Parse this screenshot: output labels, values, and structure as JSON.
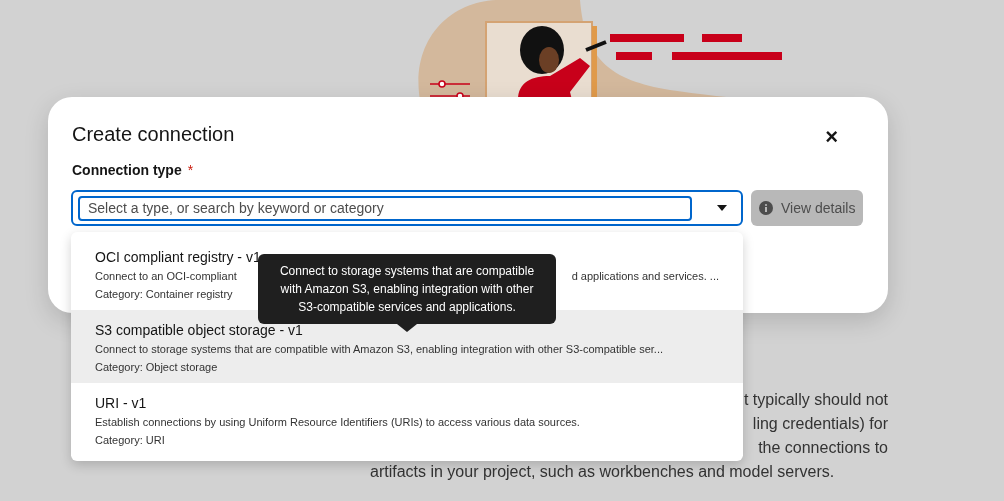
{
  "background_text": {
    "line_ends": [
      "t typically should not",
      "ling credentials) for",
      "the connections to"
    ],
    "last_line": "artifacts in your project, such as workbenches and model servers."
  },
  "modal": {
    "title": "Create connection",
    "close": "×",
    "field": {
      "label": "Connection type",
      "required": "*",
      "placeholder": "Select a type, or search by keyword or category"
    },
    "view_details": {
      "label": "View details",
      "disabled": true
    }
  },
  "dropdown": {
    "items": [
      {
        "title": "OCI compliant registry - v1",
        "description": [
          "Connect to an OCI-compliant",
          "d applications and services. ..."
        ],
        "category": "Category: Container registry",
        "highlighted": false
      },
      {
        "title": "S3 compatible object storage - v1",
        "description": [
          "Connect to storage systems that are compatible with Amazon S3, enabling integration with other S3-compatible ser..."
        ],
        "category": "Category: Object storage",
        "highlighted": true
      },
      {
        "title": "URI - v1",
        "description": [
          "Establish connections by using Uniform Resource Identifiers (URIs) to access various data sources."
        ],
        "category": "Category: URI",
        "highlighted": false
      }
    ]
  },
  "tooltip": {
    "text": "Connect to storage systems that are compatible with Amazon S3, enabling integration with other S3-compatible services and applications."
  }
}
